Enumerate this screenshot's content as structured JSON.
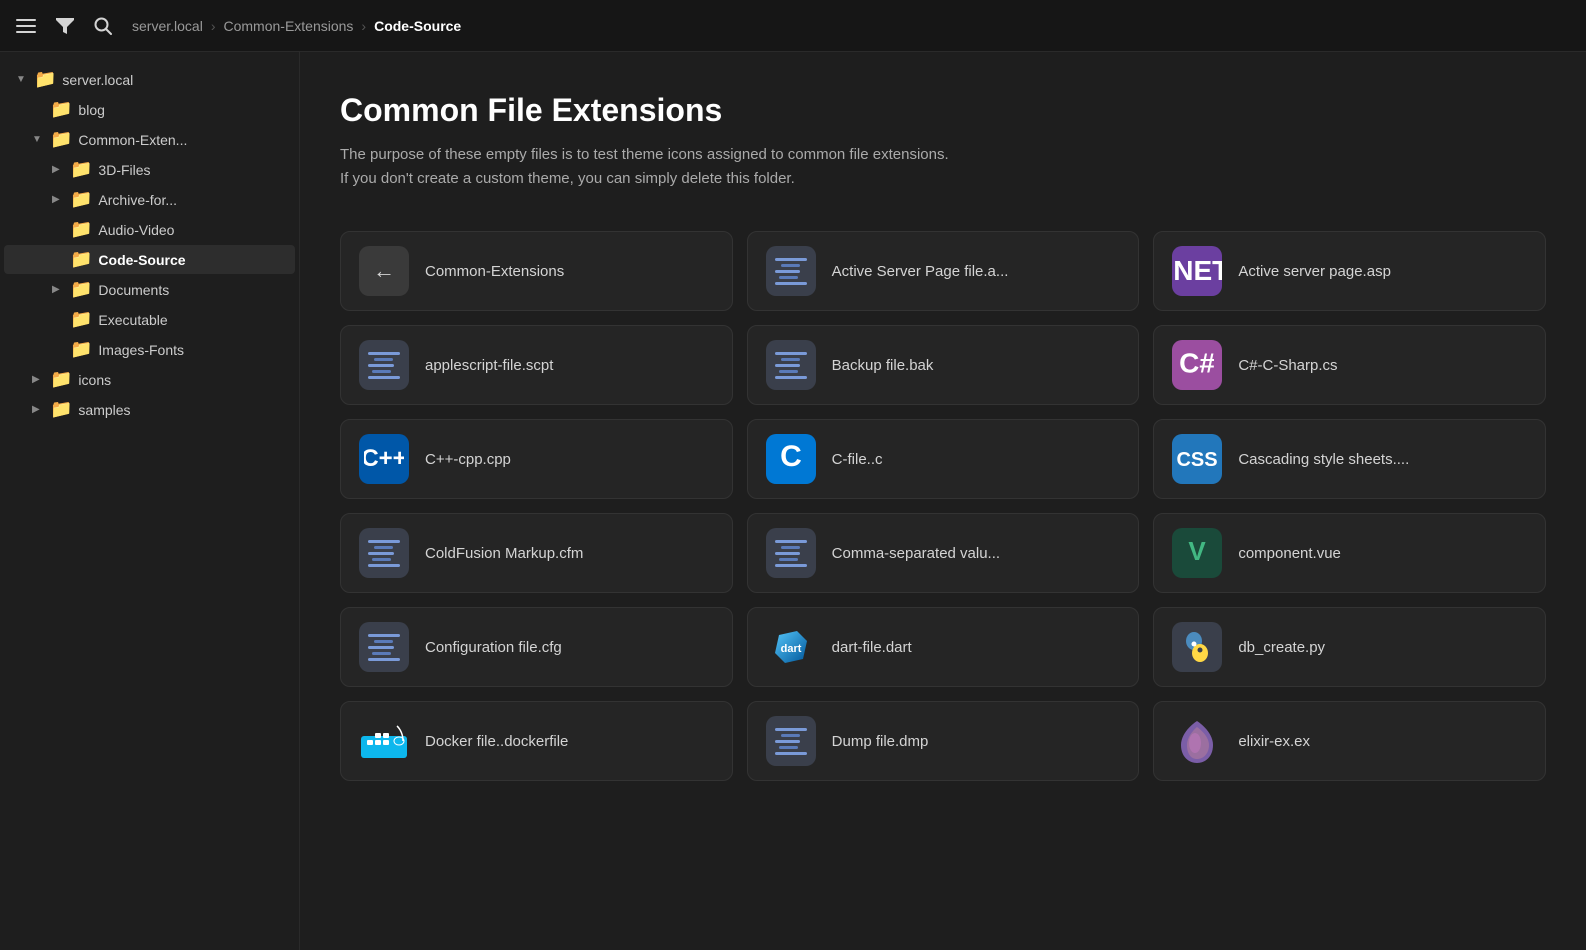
{
  "topbar": {
    "menu_icon": "☰",
    "filter_icon": "⊻",
    "search_icon": "🔍",
    "breadcrumb": [
      {
        "label": "server.local",
        "is_current": false
      },
      {
        "label": "Common-Extensions",
        "is_current": false
      },
      {
        "label": "Code-Source",
        "is_current": true
      }
    ]
  },
  "sidebar": {
    "items": [
      {
        "id": "server-local",
        "label": "server.local",
        "indent": 0,
        "type": "folder",
        "expanded": true,
        "color": "yellow"
      },
      {
        "id": "blog",
        "label": "blog",
        "indent": 1,
        "type": "folder",
        "expanded": false,
        "color": "blue"
      },
      {
        "id": "common-extensions",
        "label": "Common-Exten...",
        "indent": 1,
        "type": "folder",
        "expanded": true,
        "color": "yellow"
      },
      {
        "id": "3d-files",
        "label": "3D-Files",
        "indent": 2,
        "type": "folder",
        "expanded": false,
        "color": "yellow"
      },
      {
        "id": "archive-for",
        "label": "Archive-for...",
        "indent": 2,
        "type": "folder",
        "expanded": false,
        "color": "yellow"
      },
      {
        "id": "audio-video",
        "label": "Audio-Video",
        "indent": 2,
        "type": "folder",
        "expanded": false,
        "color": "yellow"
      },
      {
        "id": "code-source",
        "label": "Code-Source",
        "indent": 2,
        "type": "folder",
        "expanded": false,
        "color": "yellow",
        "active": true
      },
      {
        "id": "documents",
        "label": "Documents",
        "indent": 2,
        "type": "folder",
        "expanded": false,
        "color": "yellow"
      },
      {
        "id": "executable",
        "label": "Executable",
        "indent": 2,
        "type": "folder",
        "expanded": false,
        "color": "yellow"
      },
      {
        "id": "images-fonts",
        "label": "Images-Fonts",
        "indent": 2,
        "type": "folder",
        "expanded": false,
        "color": "yellow"
      },
      {
        "id": "icons",
        "label": "icons",
        "indent": 1,
        "type": "folder",
        "expanded": false,
        "color": "yellow"
      },
      {
        "id": "samples",
        "label": "samples",
        "indent": 1,
        "type": "folder",
        "expanded": false,
        "color": "yellow"
      }
    ]
  },
  "content": {
    "title": "Common File Extensions",
    "description_line1": "The purpose of these empty files is to test theme icons assigned to common file extensions.",
    "description_line2": "If you don't create a custom theme, you can simply delete this folder.",
    "back_button_label": "Common-Extensions",
    "files": [
      {
        "id": "back",
        "label": "Common-Extensions",
        "icon_type": "back"
      },
      {
        "id": "asp-a",
        "label": "Active Server Page file.a...",
        "icon_type": "code"
      },
      {
        "id": "asp",
        "label": "Active server page.asp",
        "icon_type": "net"
      },
      {
        "id": "applescript",
        "label": "applescript-file.scpt",
        "icon_type": "code"
      },
      {
        "id": "bak",
        "label": "Backup file.bak",
        "icon_type": "code"
      },
      {
        "id": "cs",
        "label": "C#-C-Sharp.cs",
        "icon_type": "csharp"
      },
      {
        "id": "cpp",
        "label": "C++-cpp.cpp",
        "icon_type": "cpp"
      },
      {
        "id": "c",
        "label": "C-file..c",
        "icon_type": "c"
      },
      {
        "id": "css",
        "label": "Cascading style sheets....",
        "icon_type": "css"
      },
      {
        "id": "cfm",
        "label": "ColdFusion Markup.cfm",
        "icon_type": "code"
      },
      {
        "id": "csv",
        "label": "Comma-separated valu...",
        "icon_type": "code"
      },
      {
        "id": "vue",
        "label": "component.vue",
        "icon_type": "vue"
      },
      {
        "id": "cfg",
        "label": "Configuration file.cfg",
        "icon_type": "code"
      },
      {
        "id": "dart",
        "label": "dart-file.dart",
        "icon_type": "dart"
      },
      {
        "id": "py",
        "label": "db_create.py",
        "icon_type": "python"
      },
      {
        "id": "dockerfile",
        "label": "Docker file..dockerfile",
        "icon_type": "docker"
      },
      {
        "id": "dmp",
        "label": "Dump file.dmp",
        "icon_type": "code"
      },
      {
        "id": "ex",
        "label": "elixir-ex.ex",
        "icon_type": "elixir"
      }
    ]
  }
}
